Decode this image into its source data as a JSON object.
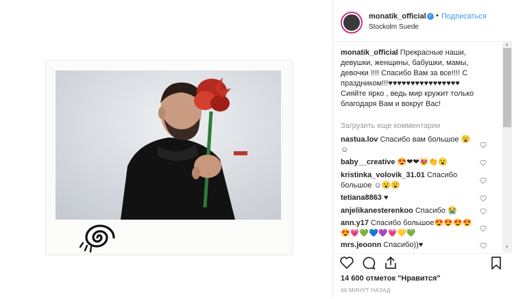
{
  "post": {
    "username": "monatik_official",
    "verified_badge": "✓",
    "separator": "•",
    "follow_label": "Подписаться",
    "location": "Stockolm Suede"
  },
  "caption": {
    "username": "monatik_official",
    "text": " Прекрасные наши, девушки, женщины, бабушки, мамы, девочки !!!! Спасибо Вам за все!!!! С праздником!!!♥♥♥♥♥♥♥♥♥♥♥♥♥♥♥♥ Сияйте ярко , ведь мир кружит только благодаря Вам и вокруг Вас!"
  },
  "load_more_label": "Загрузить еще комментарии",
  "comments": [
    {
      "user": "nastua.lov",
      "text": " Спасибо вам большое 😮 ☺"
    },
    {
      "user": "baby__creative",
      "text": " 😍❤❤😻👏😮"
    },
    {
      "user": "kristinka_volovik_31.01",
      "text": " Спасибо большое ☺😮😮"
    },
    {
      "user": "tetiana8863",
      "text": " ♥"
    },
    {
      "user": "anjelikanesterenkoo",
      "text": " Спасибо 😭"
    },
    {
      "user": "ann.y17",
      "text": " Спасибо большое😍😍😍😍 😍💗💚💙💜💗💛💚"
    },
    {
      "user": "mrs.jeoonn",
      "text": " Спасибо))♥"
    }
  ],
  "likes_text": "14 600 отметок \"Нравится\"",
  "time_ago": "46 МИНУТ НАЗАД",
  "icons": {
    "like": "heart-icon",
    "comment": "comment-icon",
    "share": "share-icon",
    "save": "bookmark-icon"
  },
  "colors": {
    "link_blue": "#3897f0",
    "text": "#262626",
    "muted": "#999999",
    "avatar_ring": "#c13584"
  }
}
